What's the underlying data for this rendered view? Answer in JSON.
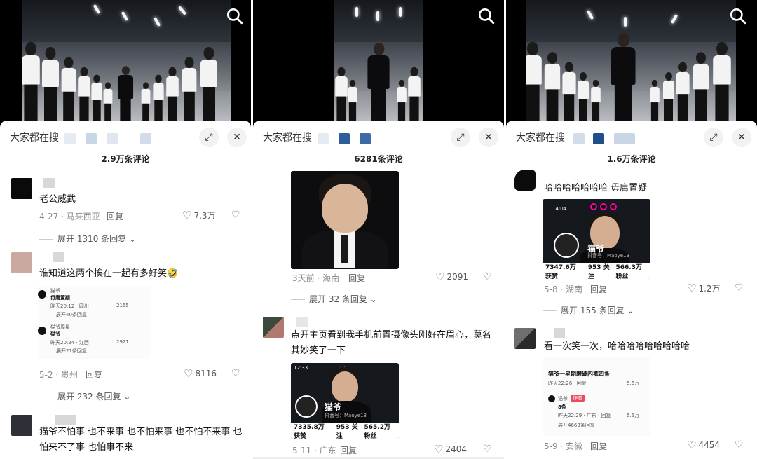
{
  "panels": [
    {
      "trending": "大家都在搜",
      "comment_count": "2.9万条评论",
      "comments": [
        {
          "text": "老公威武",
          "meta": "4-27 · 马来西亚",
          "reply": "回复",
          "likes": "7.3万",
          "expand": "展开 1310 条回复"
        },
        {
          "text": "谁知道这两个挨在一起有多好笑🤣",
          "meta": "5-2 · 贵州",
          "reply": "回复",
          "likes": "8116",
          "expand": "展开 232 条回复",
          "embedded": [
            {
              "name": "猫爷",
              "text": "毋庸置疑",
              "meta": "昨天20:12 · 四川",
              "reply": "回复",
              "likes": "2155",
              "expand": "展开40条回复"
            },
            {
              "name": "猫爷周星",
              "text": "猫爷",
              "meta": "昨天20:24 · 江西",
              "reply": "回复",
              "likes": "2921",
              "expand": "展开21条回复"
            }
          ]
        },
        {
          "text": "猫爷不怕事 也不来事 也不怕来事 也不怕不来事 也怕来不了事 也怕事不来"
        }
      ]
    },
    {
      "trending": "大家都在搜",
      "comment_count": "6281条评论",
      "comments": [
        {
          "meta": "3天前 · 海南",
          "reply": "回复",
          "likes": "2091",
          "expand": "展开 32 条回复"
        },
        {
          "text": "点开主页看到我手机前置摄像头刚好在眉心，莫名其妙笑了一下",
          "meta": "5-11 · 广东",
          "reply": "回复",
          "likes": "2404",
          "phone": {
            "time": "12:33",
            "name": "猫爷",
            "id": "抖音号：Maoye13",
            "stats": [
              "7335.8万 获赞",
              "953 关注",
              "565.2万 粉丝"
            ]
          }
        }
      ]
    },
    {
      "trending": "大家都在搜",
      "comment_count": "1.6万条评论",
      "comments": [
        {
          "text": "哈哈哈哈哈哈哈 毋庸置疑",
          "meta": "5-8 · 湖南",
          "reply": "回复",
          "likes": "1.2万",
          "expand": "展开 155 条回复",
          "phone": {
            "time": "14:04",
            "name": "猫爷",
            "id": "抖音号：Maoye13",
            "stats": [
              "7347.6万 获赞",
              "953 关注",
              "566.3万 粉丝"
            ]
          }
        },
        {
          "text": "看一次笑一次，哈哈哈哈哈哈哈哈哈",
          "meta": "5-9 · 安徽",
          "reply": "回复",
          "likes": "4454",
          "embedded": [
            {
              "title": "猫爷一星期磨破内裤四条",
              "meta": "昨天22:26 · 回复",
              "likes": "5.6万"
            },
            {
              "name": "猫爷",
              "badge": "作者",
              "text": "8条",
              "meta": "昨天22:29 · 广东 · 回复",
              "likes": "5.5万",
              "expand": "展开4669条回复"
            }
          ]
        }
      ]
    }
  ],
  "icons": {
    "search": "search-icon",
    "expand": "expand-icon",
    "close": "close-icon",
    "heart": "heart-icon",
    "dislike": "dislike-icon"
  },
  "colors": {
    "chip_blue": "#2f5d9b",
    "chip_light": "#c9d6e5"
  }
}
